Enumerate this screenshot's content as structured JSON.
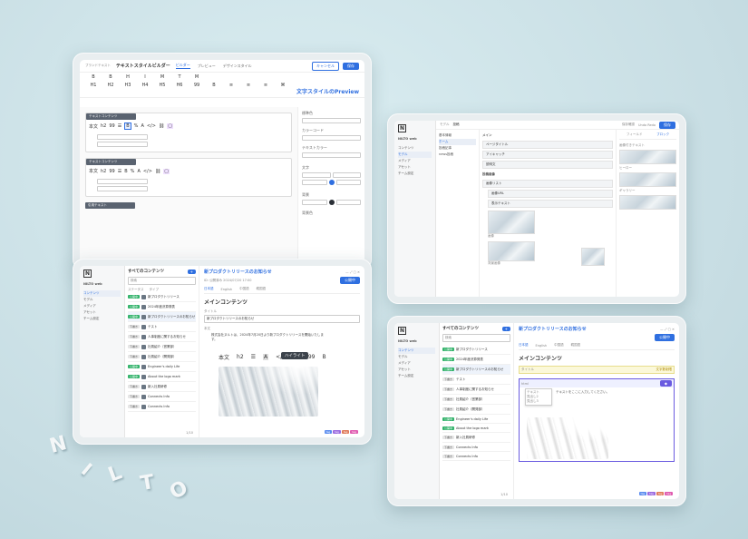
{
  "colors": {
    "accent": "#2f6fe0",
    "background": "#cfe3e8",
    "green": "#33b36b"
  },
  "t1": {
    "app_title": "テキストスタイルビルダー",
    "breadcrumb": "ブランドテキスト",
    "tabs": [
      "ビルダー",
      "プレビュー",
      "デザインスタイル"
    ],
    "cancel": "キャンセル",
    "save": "保存",
    "preview_title": "文字スタイルのPreview",
    "toolbar_row1": [
      "B",
      "B",
      "H",
      "I",
      "M",
      "T",
      "M",
      "",
      "",
      "",
      "",
      ""
    ],
    "toolbar_row2": [
      "H1",
      "H2",
      "H3",
      "H4",
      "H5",
      "H6",
      "99",
      "B",
      "≡",
      "≡",
      "≡",
      "⌘"
    ],
    "block1_label": "テキストコンテンツ",
    "block2_label": "テキストコンテンツ",
    "block3_label": "引用テキスト",
    "rt_items": [
      "本文",
      "h2",
      "99",
      "☰",
      "B",
      "%",
      "A",
      "</>",
      "⛓",
      "▢"
    ],
    "side_fields": [
      "標準色",
      "カラーコード",
      "テキストカラー",
      "文字",
      "背景",
      "背景色"
    ]
  },
  "t2": {
    "brand": "NILTO",
    "brand_sub": "NILTO web",
    "nav": [
      "コンテンツ",
      "モデル",
      "メディア",
      "アセット",
      "チーム設定"
    ],
    "top_left": [
      "モデル",
      "投稿"
    ],
    "top_right": [
      "保存確認",
      "Undo Redo"
    ],
    "save": "保存",
    "col2": [
      "基本情報",
      "ホーム",
      "投稿記事",
      "news投稿"
    ],
    "col3_sections": [
      "メイン",
      "投稿画像"
    ],
    "col3_fields": [
      "ページタイトル",
      "アイキャッチ",
      "説明文",
      "タグ"
    ],
    "col3_sub": [
      "画像リスト",
      "画像URL",
      "表示テキスト"
    ],
    "col4_tabs": [
      "フィールド",
      "ブロック"
    ],
    "col4_items": [
      "画像付きテキスト",
      "ヒーロー",
      "ギャラリー"
    ],
    "img_labels": [
      "画像",
      "背景画像"
    ]
  },
  "t3": {
    "brand": "NILTO",
    "brand_sub": "NILTO web",
    "list_title": "すべてのコンテンツ",
    "status_filter": "ステータス",
    "type_filter": "タイプ",
    "search_placeholder": "検索",
    "nav": [
      "コンテンツ",
      "モデル",
      "メディア",
      "アセット",
      "チーム設定"
    ],
    "items": [
      {
        "badge": "公開中",
        "title": "新プロダクトリリース"
      },
      {
        "badge": "公開中",
        "title": "2024年度決算発表"
      },
      {
        "badge": "公開中",
        "title": "新プロダクトリリースのお知らせ"
      },
      {
        "badge": "下書き",
        "title": "テスト"
      },
      {
        "badge": "下書き",
        "title": "人事制度に関するお知らせ"
      },
      {
        "badge": "下書き",
        "title": "社員紹介（営業部）"
      },
      {
        "badge": "下書き",
        "title": "社員紹介（開発部）"
      },
      {
        "badge": "公開中",
        "title": "Engineer's daily Life"
      },
      {
        "badge": "公開中",
        "title": "About the logo mark"
      },
      {
        "badge": "下書き",
        "title": "新入社員研修"
      },
      {
        "badge": "下書き",
        "title": "Connects Info"
      },
      {
        "badge": "下書き",
        "title": "Connects Info"
      }
    ],
    "doc_title": "新プロダクトリリースのお知らせ",
    "doc_meta": "ID: 公開済み 2024/07/20 17:00",
    "doc_tabs": [
      "日本語",
      "English",
      "中国語",
      "韓国語"
    ],
    "status_btn": "公開中",
    "section_title": "メインコンテンツ",
    "field_title": "タイトル",
    "field_value": "新プロダクトリリースのお知らせ",
    "body_label": "本文",
    "body_text": "株式会社ヌルトは、2024年7月20日より新プロダクトリリースを開始いたします。",
    "tooltip": "ハイライト",
    "toolbar": [
      "本文",
      "h2",
      "☰",
      "A",
      "</>",
      "⛓",
      "99",
      "B"
    ],
    "pagination": "1/10"
  },
  "t4": {
    "brand": "NILTO",
    "brand_sub": "NILTO web",
    "list_title": "すべてのコンテンツ",
    "doc_title": "新プロダクトリリースのお知らせ",
    "section_title": "メインコンテンツ",
    "field_title": "タイトル",
    "badge_right": "文字数制限",
    "editor_mode": "html",
    "popup_items": [
      "テキスト",
      "見出し2",
      "見出し3"
    ],
    "editor_text": "テキストをここに入力してください。",
    "pagination": "1/10"
  },
  "letters": [
    "N",
    "I",
    "L",
    "T",
    "O"
  ]
}
